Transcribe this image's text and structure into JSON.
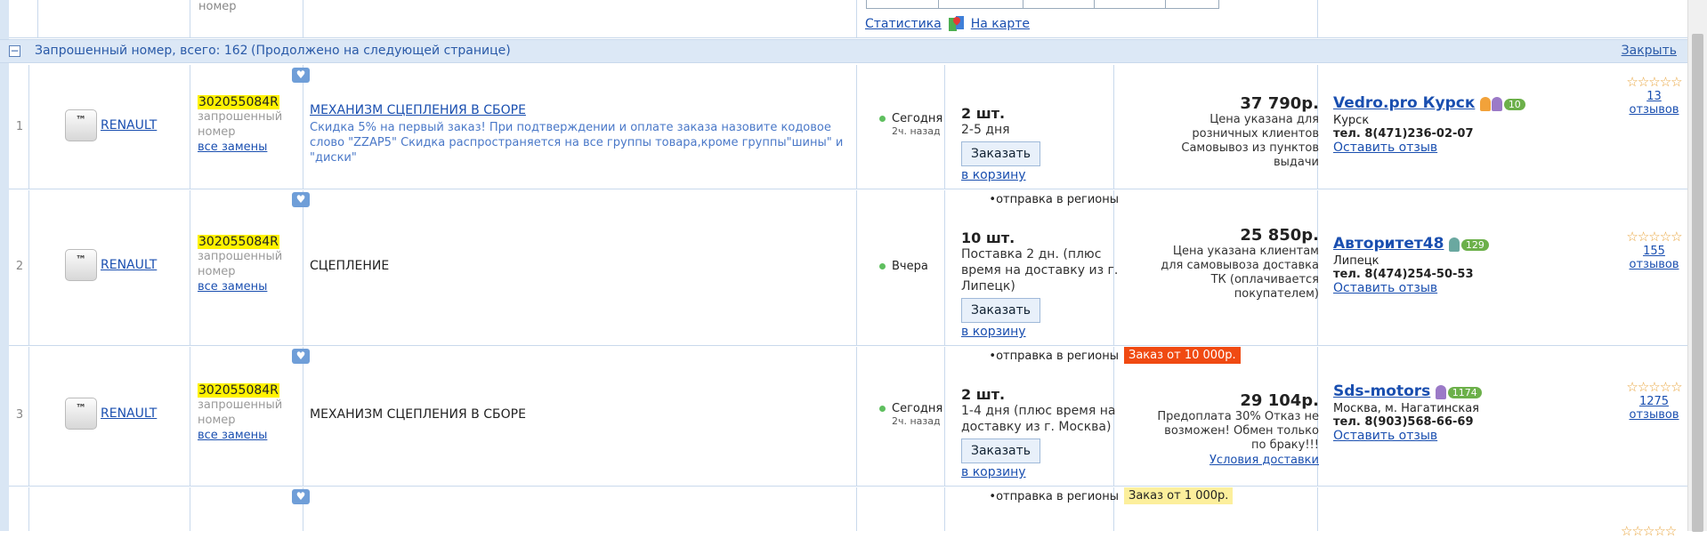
{
  "top": {
    "gray_text": "номер",
    "stats_link": "Статистика",
    "map_link": "На карте"
  },
  "group": {
    "title": "Запрошенный номер, всего: 162",
    "continued": "(Продолжено на следующей странице)",
    "close": "Закрыть"
  },
  "labels": {
    "order_button": "Заказать",
    "cart_link": "в корзину",
    "review_link": "Оставить отзыв",
    "requested": "запрошенный номер",
    "all_replacements": "все замены",
    "regions": "•отправка в регионы",
    "tm": "™"
  },
  "rows": [
    {
      "num": "1",
      "brand": "RENAULT",
      "part": "302055084R",
      "title": "МЕХАНИЗМ СЦЕПЛЕНИЯ В СБОРЕ",
      "note": "Скидка 5% на первый заказ! При подтверждении и оплате заказа назовите кодовое слово \"ZZAP5\" Скидка распространяется на все группы товара,кроме группы\"шины\" и \"диски\"",
      "date": "Сегодня",
      "ago": "2ч. назад",
      "qty": "2 шт.",
      "term": "2-5 дня",
      "price": "37 790р.",
      "price_note": "Цена указана для розничных клиентов Самовывоз из пунктов выдачи",
      "seller": "Vedro.pro Курск",
      "badge": "10",
      "city": "Курск",
      "tel": "тел. 8(471)236-02-07",
      "reviews": "13 отзывов"
    },
    {
      "num": "2",
      "brand": "RENAULT",
      "part": "302055084R",
      "title": "СЦЕПЛЕНИЕ",
      "date": "Вчера",
      "qty": "10 шт.",
      "term": "Поставка 2 дн. (плюс время на доставку из г. Липецк)",
      "price": "25 850р.",
      "price_note": "Цена указана клиентам для самовывоза доставка ТК (оплачивается покупателем)",
      "seller": "Авторитет48",
      "badge": "129",
      "city": "Липецк",
      "tel": "тел. 8(474)254-50-53",
      "reviews": "155 отзывов"
    },
    {
      "num": "3",
      "brand": "RENAULT",
      "part": "302055084R",
      "title": "МЕХАНИЗМ СЦЕПЛЕНИЯ В СБОРЕ",
      "date": "Сегодня",
      "ago": "2ч. назад",
      "qty": "2 шт.",
      "term": "1-4 дня (плюс время на доставку из г. Москва)",
      "order_min": "Заказ от 10 000р.",
      "price": "29 104р.",
      "price_note": "Предоплата 30% Отказ не возможен! Обмен только по браку!!!",
      "delivery_link": "Условия доставки",
      "seller": "Sds-motors",
      "badge": "1174",
      "city": "Москва, м. Нагатинская",
      "tel": "тел. 8(903)568-66-69",
      "reviews": "1275 отзывов"
    },
    {
      "order_min": "Заказ от 1 000р."
    }
  ],
  "colors": {
    "accent": "#1a4fb0",
    "header_bg": "#dce8f6",
    "highlight": "#fff200",
    "order_min_red": "#f04a12",
    "order_min_yellow": "#fcef9c",
    "badge_green": "#6cb04a"
  },
  "icons": [
    "heart-icon",
    "map-icon",
    "collapse-icon",
    "star-icon",
    "ribbon-icon",
    "tm-logo"
  ]
}
